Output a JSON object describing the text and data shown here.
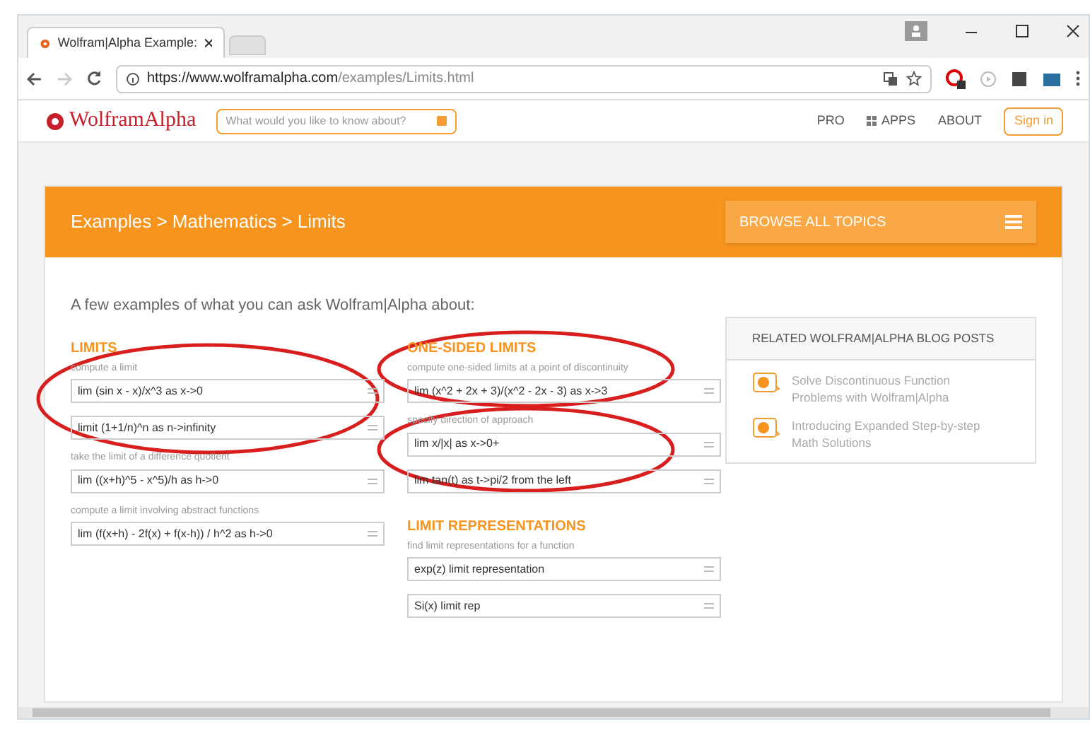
{
  "browser": {
    "tab_title": "Wolfram|Alpha Example:",
    "url_host": "https://www.wolframalpha.com",
    "url_path": "/examples/Limits.html"
  },
  "site_header": {
    "logo": "WolframAlpha",
    "search_placeholder": "What would you like to know about?",
    "nav": [
      "PRO",
      "APPS",
      "ABOUT"
    ],
    "sign_in": "Sign in"
  },
  "banner": {
    "breadcrumb": "Examples > Mathematics > Limits",
    "browse": "BROWSE ALL TOPICS"
  },
  "intro": "A few examples of what you can ask Wolfram|Alpha about:",
  "columns": [
    [
      {
        "heading": "LIMITS",
        "groups": [
          {
            "label": "compute a limit",
            "fields": [
              "lim (sin x - x)/x^3 as x->0",
              "limit (1+1/n)^n as n->infinity"
            ]
          },
          {
            "label": "take the limit of a difference quotient",
            "fields": [
              "lim ((x+h)^5 - x^5)/h as h->0"
            ]
          },
          {
            "label": "compute a limit involving abstract functions",
            "fields": [
              "lim (f(x+h) - 2f(x) + f(x-h)) / h^2 as h->0"
            ]
          }
        ]
      }
    ],
    [
      {
        "heading": "ONE-SIDED LIMITS",
        "groups": [
          {
            "label": "compute one-sided limits at a point of discontinuity",
            "fields": [
              "lim (x^2 + 2x + 3)/(x^2 - 2x - 3) as x->3"
            ]
          },
          {
            "label": "specify direction of approach",
            "fields": [
              "lim x/|x| as x->0+",
              "lim tan(t) as t->pi/2 from the left"
            ]
          }
        ]
      },
      {
        "heading": "LIMIT REPRESENTATIONS",
        "groups": [
          {
            "label": "find limit representations for a function",
            "fields": [
              "exp(z) limit representation",
              "Si(x) limit rep"
            ]
          }
        ]
      }
    ]
  ],
  "blog": {
    "title": "RELATED WOLFRAM|ALPHA BLOG POSTS",
    "posts": [
      "Solve Discontinuous Function Problems with Wolfram|Alpha",
      "Introducing Expanded Step-by-step Math Solutions"
    ]
  }
}
